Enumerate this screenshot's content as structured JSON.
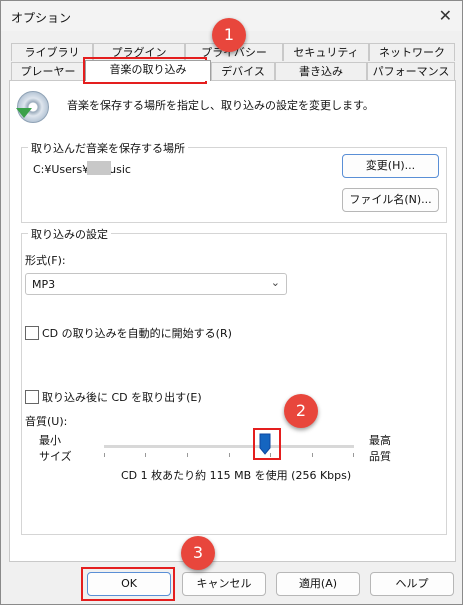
{
  "window": {
    "title": "オプション",
    "close": "✕"
  },
  "tabs_back": [
    "ライブラリ",
    "プラグイン",
    "プライバシー",
    "セキュリティ",
    "ネットワーク"
  ],
  "tabs_front": [
    "プレーヤー",
    "音楽の取り込み",
    "デバイス",
    "書き込み",
    "パフォーマンス"
  ],
  "panel": {
    "description": "音楽を保存する場所を指定し、取り込みの設定を変更します。",
    "save_location": {
      "group_label": "取り込んだ音楽を保存する場所",
      "path": "C:¥Users¥      ¥Music",
      "change_button": "変更(H)...",
      "filename_button": "ファイル名(N)..."
    },
    "rip_settings": {
      "group_label": "取り込みの設定",
      "format_label": "形式(F):",
      "format_value": "MP3",
      "auto_rip": "CD の取り込みを自動的に開始する(R)",
      "eject": "取り込み後に CD を取り出す(E)",
      "quality_label": "音質(U):",
      "quality_min": "最小\nサイズ",
      "quality_max": "最高\n品質",
      "quality_info": "CD 1 枚あたり約 115 MB を使用 (256 Kbps)",
      "quality_level": 0.64
    }
  },
  "buttons": {
    "ok": "OK",
    "cancel": "キャンセル",
    "apply": "適用(A)",
    "help": "ヘルプ"
  },
  "badges": [
    "1",
    "2",
    "3"
  ],
  "colors": {
    "highlight": "#e41e1e",
    "badge": "#e8463c",
    "slider": "#1565c0"
  }
}
